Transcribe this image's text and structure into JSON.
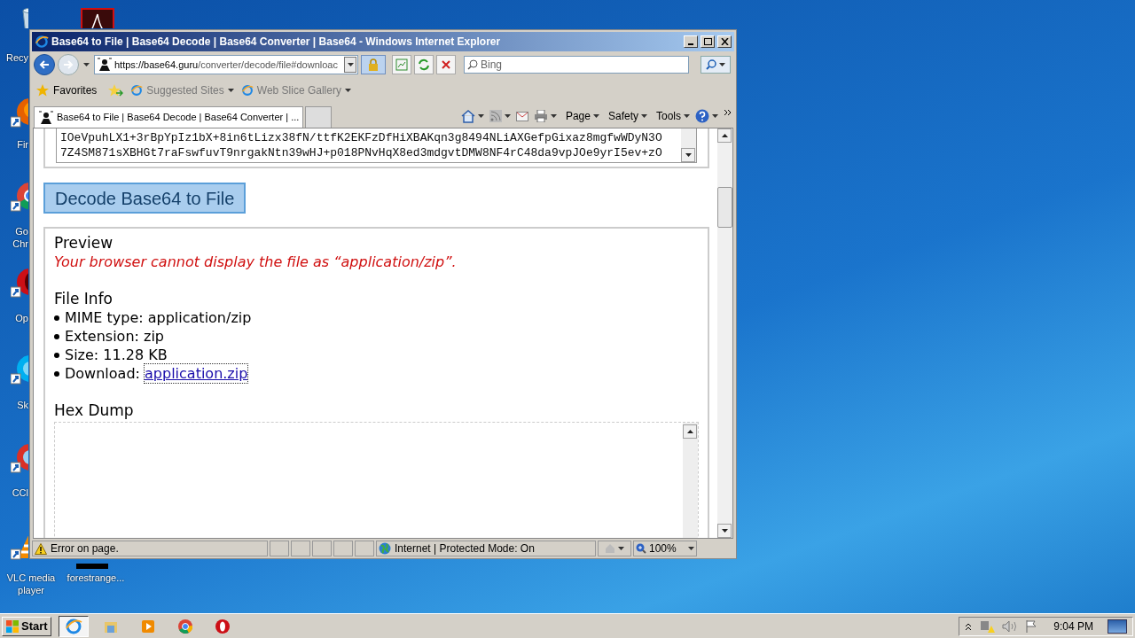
{
  "desktop": {
    "icons": [
      {
        "kind": "recycle",
        "label": "Recy"
      },
      {
        "kind": "pdf"
      },
      {
        "kind": "firefox",
        "label": "Fir"
      },
      {
        "kind": "chrome",
        "label": "Go Chr"
      },
      {
        "kind": "opera",
        "label": "Op"
      },
      {
        "kind": "skype",
        "label": "Sk"
      },
      {
        "kind": "ccleaner",
        "label": "CCl"
      },
      {
        "kind": "vlc",
        "label": "VLC media player"
      },
      {
        "kind": "file",
        "label": "forestrange..."
      }
    ]
  },
  "window": {
    "title": "Base64 to File | Base64 Decode | Base64 Converter | Base64 - Windows Internet Explorer",
    "address": {
      "host": "https://base64.guru",
      "path": "/converter/decode/file#downloac"
    },
    "search": {
      "placeholder": "Bing"
    },
    "favorites": {
      "label": "Favorites",
      "items": [
        "Suggested Sites",
        "Web Slice Gallery"
      ]
    },
    "tabs": [
      {
        "label": "Base64 to File | Base64 Decode | Base64 Converter | ...",
        "selected": true
      }
    ],
    "commands": [
      "Page",
      "Safety",
      "Tools"
    ],
    "page": {
      "base64_lines": [
        "IOeVpuhLX1+3rBpYpIz1bX+8in6tLizx38fN/ttfK2EKFzDfHiXBAKqn3g8494NLiAXGefpGixaz8mgfwWDyN3O",
        "7Z4SM871sXBHGt7raFswfuvT9nrgakNtn39wHJ+p018PNvHqX8ed3mdgvtDMW8NF4rC48da9vpJOe9yrI5ev+zO"
      ],
      "decode_button": "Decode Base64 to File",
      "preview_heading": "Preview",
      "preview_message": "Your browser cannot display the file as “application/zip”.",
      "file_info_heading": "File Info",
      "file_info": [
        {
          "text": "MIME type: application/zip"
        },
        {
          "text": "Extension: zip"
        },
        {
          "text": "Size: 11.28 KB"
        },
        {
          "text": "Download: ",
          "link": "application.zip"
        }
      ],
      "hex_dump_heading": "Hex Dump"
    },
    "status_bar": {
      "message": "Error on page.",
      "zone": "Internet | Protected Mode: On",
      "zoom": "100%"
    }
  },
  "taskbar": {
    "start": "Start",
    "apps": [
      {
        "kind": "ie",
        "selected": true
      },
      {
        "kind": "explorer",
        "selected": false
      },
      {
        "kind": "media",
        "selected": false
      },
      {
        "kind": "chrome",
        "selected": false
      },
      {
        "kind": "opera",
        "selected": false
      }
    ],
    "clock": "9:04 PM"
  }
}
